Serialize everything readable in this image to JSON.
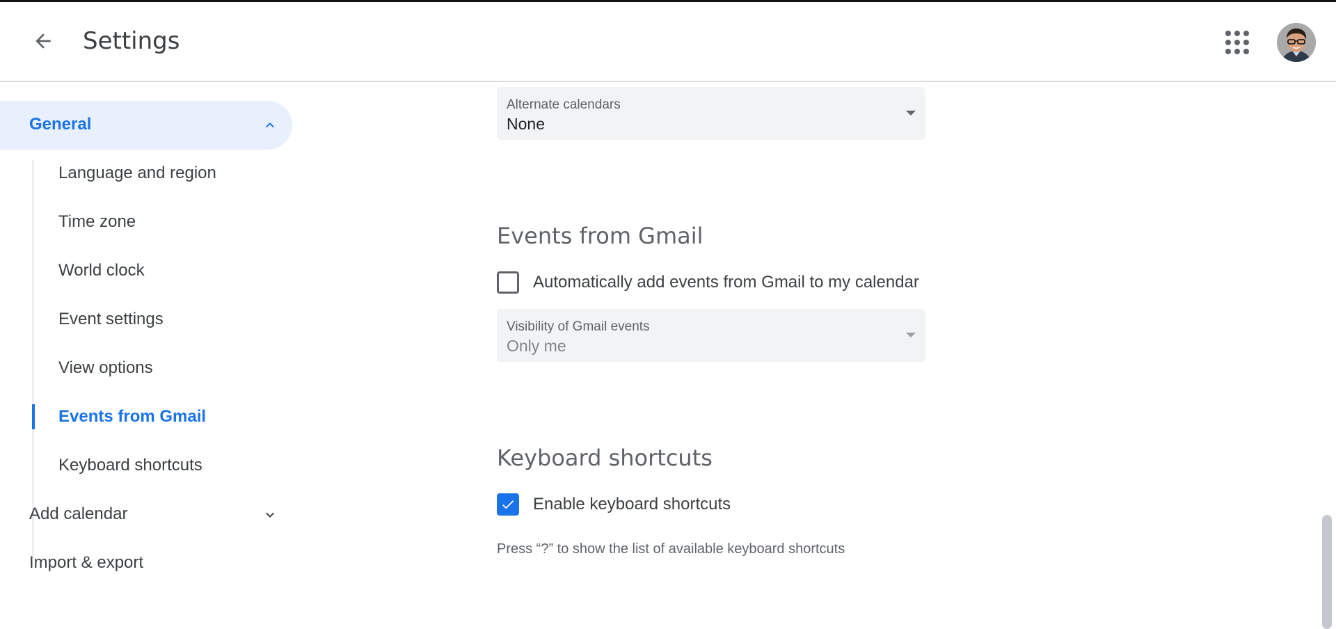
{
  "header": {
    "back_icon": "arrow-back-icon",
    "title": "Settings",
    "apps_icon": "apps-grid-icon",
    "avatar_alt": "Account avatar"
  },
  "sidebar": {
    "general": {
      "label": "General",
      "icon": "chevron-up-icon",
      "expanded": true
    },
    "sub_items": [
      {
        "label": "Language and region",
        "active": false
      },
      {
        "label": "Time zone",
        "active": false
      },
      {
        "label": "World clock",
        "active": false
      },
      {
        "label": "Event settings",
        "active": false
      },
      {
        "label": "View options",
        "active": false
      },
      {
        "label": "Events from Gmail",
        "active": true
      },
      {
        "label": "Keyboard shortcuts",
        "active": false
      }
    ],
    "add_calendar": {
      "label": "Add calendar",
      "icon": "chevron-down-icon",
      "expanded": false
    },
    "import_export": {
      "label": "Import & export"
    }
  },
  "main": {
    "alternate_calendars": {
      "label": "Alternate calendars",
      "value": "None"
    },
    "events_from_gmail": {
      "title": "Events from Gmail",
      "auto_add": {
        "label": "Automatically add events from Gmail to my calendar",
        "checked": false
      },
      "visibility": {
        "label": "Visibility of Gmail events",
        "value": "Only me",
        "disabled": true
      }
    },
    "keyboard_shortcuts": {
      "title": "Keyboard shortcuts",
      "enable": {
        "label": "Enable keyboard shortcuts",
        "checked": true
      },
      "hint": "Press “?” to show the list of available keyboard shortcuts"
    }
  },
  "colors": {
    "accent": "#1a73e8",
    "nav_active_bg": "#e8f0fe",
    "field_bg": "#f1f3f4",
    "text": "#3c4043",
    "muted": "#5f6368"
  }
}
